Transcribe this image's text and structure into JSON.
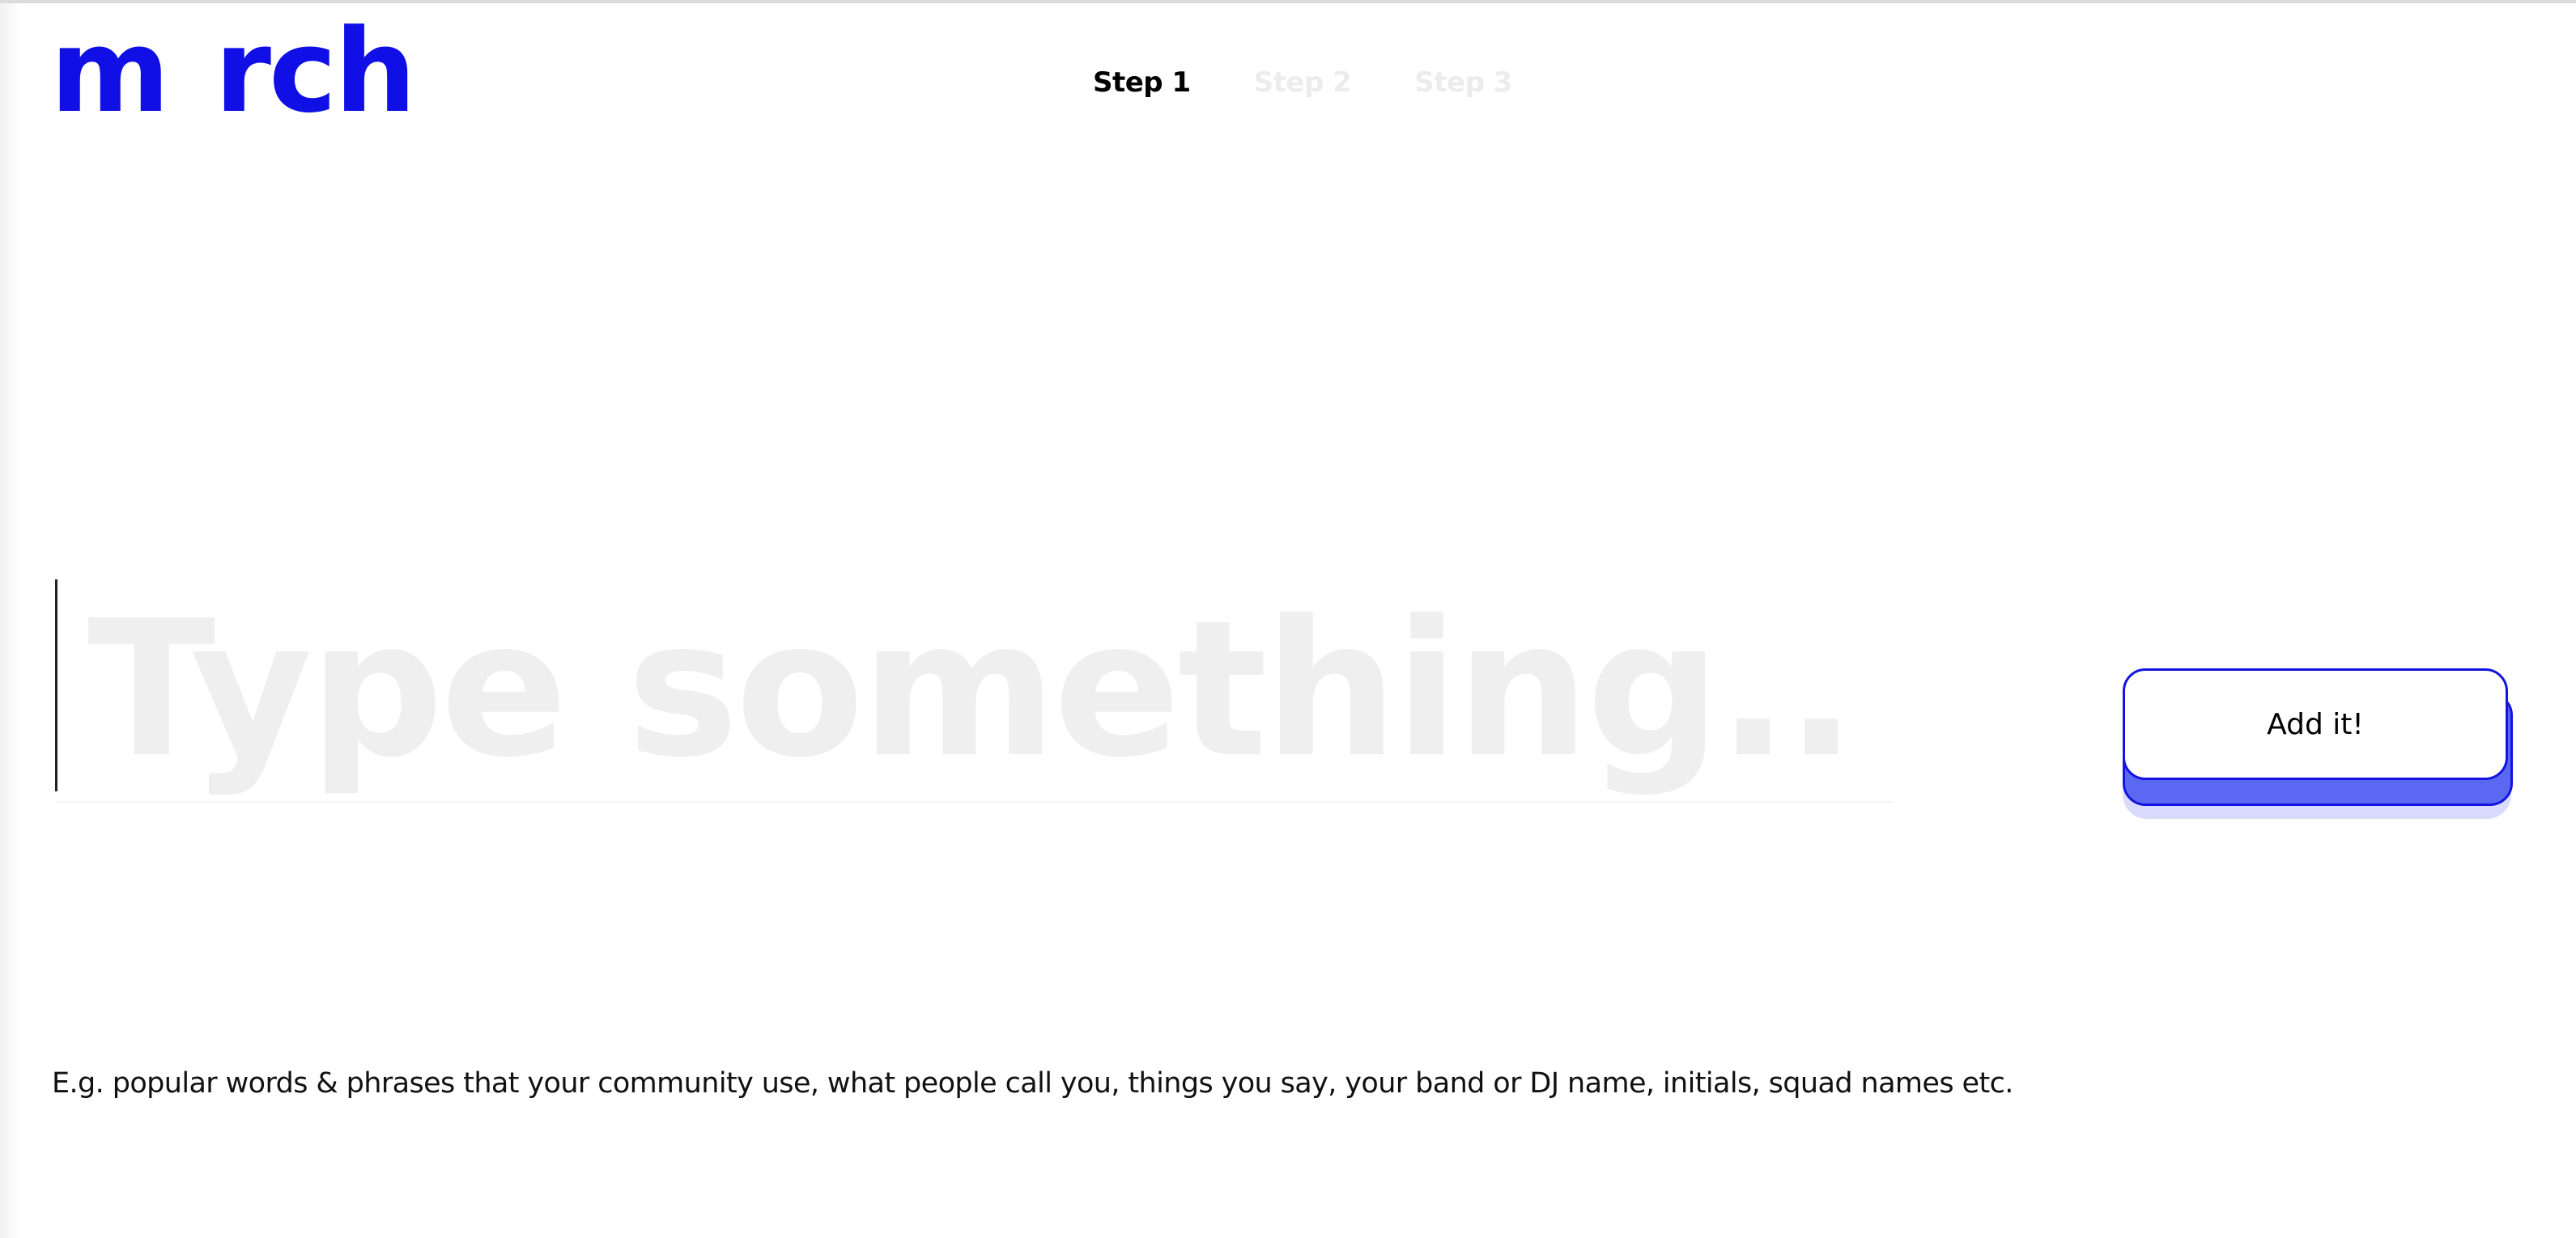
{
  "brand": {
    "logo_part1": "m",
    "logo_part2": "rch",
    "color": "#1010e6"
  },
  "steps": [
    {
      "label": "Step 1",
      "active": true
    },
    {
      "label": "Step 2",
      "active": false
    },
    {
      "label": "Step 3",
      "active": false
    }
  ],
  "entry": {
    "placeholder": "Type something...",
    "value": ""
  },
  "add_button": {
    "label": "Add it!",
    "accent": "#1414e0"
  },
  "hint": "E.g. popular words & phrases that your community use, what people call you, things you say, your band or DJ name, initials, squad names etc."
}
